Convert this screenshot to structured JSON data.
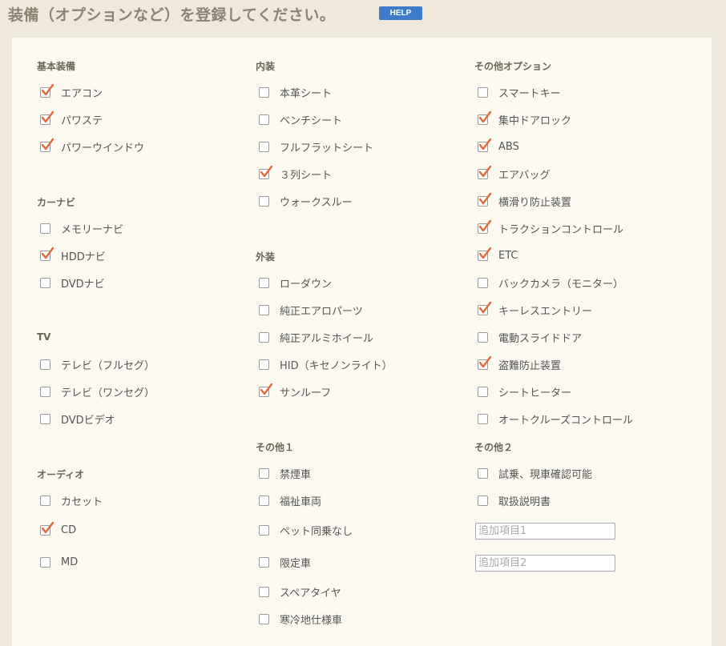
{
  "header": {
    "title": "装備（オプションなど）を登録してください。",
    "help_label": "HELP"
  },
  "sections": {
    "basic": {
      "title": "基本装備",
      "items": [
        {
          "label": "エアコン",
          "checked": true
        },
        {
          "label": "パワステ",
          "checked": true
        },
        {
          "label": "パワーウインドウ",
          "checked": true
        }
      ]
    },
    "navi": {
      "title": "カーナビ",
      "items": [
        {
          "label": "メモリーナビ",
          "checked": false
        },
        {
          "label": "HDDナビ",
          "checked": true
        },
        {
          "label": "DVDナビ",
          "checked": false
        }
      ]
    },
    "tv": {
      "title": "TV",
      "items": [
        {
          "label": "テレビ（フルセグ）",
          "checked": false
        },
        {
          "label": "テレビ（ワンセグ）",
          "checked": false
        },
        {
          "label": "DVDビデオ",
          "checked": false
        }
      ]
    },
    "audio": {
      "title": "オーディオ",
      "items": [
        {
          "label": "カセット",
          "checked": false
        },
        {
          "label": "CD",
          "checked": true
        },
        {
          "label": "MD",
          "checked": false
        }
      ]
    },
    "interior": {
      "title": "内装",
      "items": [
        {
          "label": "本革シート",
          "checked": false
        },
        {
          "label": "ベンチシート",
          "checked": false
        },
        {
          "label": "フルフラットシート",
          "checked": false
        },
        {
          "label": "３列シート",
          "checked": true
        },
        {
          "label": "ウォークスルー",
          "checked": false
        }
      ]
    },
    "exterior": {
      "title": "外装",
      "items": [
        {
          "label": "ローダウン",
          "checked": false
        },
        {
          "label": "純正エアロパーツ",
          "checked": false
        },
        {
          "label": "純正アルミホイール",
          "checked": false
        },
        {
          "label": "HID（キセノンライト）",
          "checked": false
        },
        {
          "label": "サンルーフ",
          "checked": true
        }
      ]
    },
    "other1": {
      "title": "その他１",
      "items": [
        {
          "label": "禁煙車",
          "checked": false
        },
        {
          "label": "福祉車両",
          "checked": false
        },
        {
          "label": "ペット同乗なし",
          "checked": false
        },
        {
          "label": "限定車",
          "checked": false
        },
        {
          "label": "スペアタイヤ",
          "checked": false
        },
        {
          "label": "寒冷地仕様車",
          "checked": false
        }
      ]
    },
    "other_options": {
      "title": "その他オプション",
      "items": [
        {
          "label": "スマートキー",
          "checked": false
        },
        {
          "label": "集中ドアロック",
          "checked": true
        },
        {
          "label": "ABS",
          "checked": true
        },
        {
          "label": "エアバッグ",
          "checked": true
        },
        {
          "label": "横滑り防止装置",
          "checked": true
        },
        {
          "label": "トラクションコントロール",
          "checked": true
        },
        {
          "label": "ETC",
          "checked": true
        },
        {
          "label": "バックカメラ（モニター）",
          "checked": false
        },
        {
          "label": "キーレスエントリー",
          "checked": true
        },
        {
          "label": "電動スライドドア",
          "checked": false
        },
        {
          "label": "盗難防止装置",
          "checked": true
        },
        {
          "label": "シートヒーター",
          "checked": false
        },
        {
          "label": "オートクルーズコントロール",
          "checked": false
        }
      ]
    },
    "other2": {
      "title": "その他２",
      "items": [
        {
          "label": "試乗、現車確認可能",
          "checked": false
        },
        {
          "label": "取扱説明書",
          "checked": false
        }
      ],
      "extra_fields": [
        {
          "placeholder": "追加項目1",
          "value": ""
        },
        {
          "placeholder": "追加項目2",
          "value": ""
        }
      ]
    }
  },
  "colors": {
    "check_mark": "#e06a3a",
    "help_button": "#3d7cc9",
    "page_background": "#efe9dc",
    "panel_background": "#fbf9f0"
  }
}
